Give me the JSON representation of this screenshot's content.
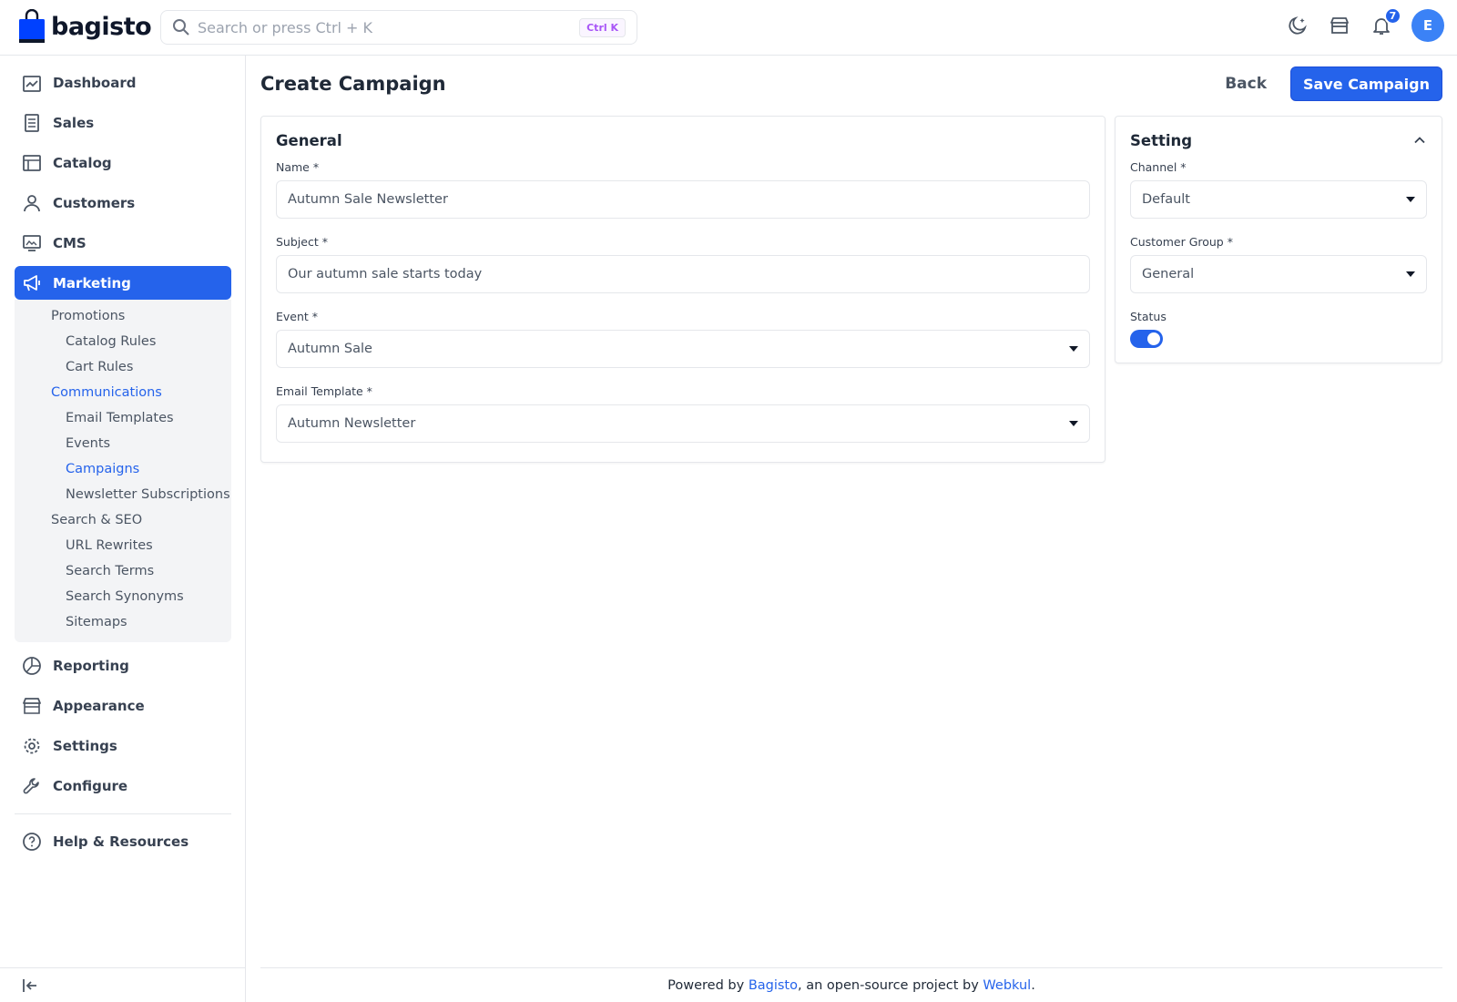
{
  "brand": {
    "name": "bagisto",
    "color": "#0041ff"
  },
  "search": {
    "placeholder": "Search or press Ctrl + K",
    "shortcut": "Ctrl K"
  },
  "header": {
    "notification_count": "7",
    "avatar_initial": "E"
  },
  "sidebar": {
    "items": [
      {
        "label": "Dashboard",
        "icon": "dashboard-icon"
      },
      {
        "label": "Sales",
        "icon": "receipt-icon"
      },
      {
        "label": "Catalog",
        "icon": "catalog-icon"
      },
      {
        "label": "Customers",
        "icon": "user-icon"
      },
      {
        "label": "CMS",
        "icon": "monitor-icon"
      },
      {
        "label": "Marketing",
        "icon": "megaphone-icon",
        "active": true
      },
      {
        "label": "Reporting",
        "icon": "pie-chart-icon"
      },
      {
        "label": "Appearance",
        "icon": "store-icon"
      },
      {
        "label": "Settings",
        "icon": "gear-icon"
      },
      {
        "label": "Configure",
        "icon": "wrench-icon"
      }
    ],
    "marketing_sub": {
      "promotions": "Promotions",
      "catalog_rules": "Catalog Rules",
      "cart_rules": "Cart Rules",
      "communications": "Communications",
      "email_templates": "Email Templates",
      "events": "Events",
      "campaigns": "Campaigns",
      "newsletter": "Newsletter Subscriptions",
      "search_seo": "Search & SEO",
      "url_rewrites": "URL Rewrites",
      "search_terms": "Search Terms",
      "search_synonyms": "Search Synonyms",
      "sitemaps": "Sitemaps"
    },
    "help": "Help & Resources"
  },
  "page": {
    "title": "Create Campaign",
    "back_label": "Back",
    "save_label": "Save Campaign"
  },
  "general": {
    "title": "General",
    "name_label": "Name *",
    "name_value": "Autumn Sale Newsletter",
    "subject_label": "Subject *",
    "subject_value": "Our autumn sale starts today",
    "event_label": "Event *",
    "event_value": "Autumn Sale",
    "template_label": "Email Template *",
    "template_value": "Autumn Newsletter"
  },
  "setting": {
    "title": "Setting",
    "channel_label": "Channel *",
    "channel_value": "Default",
    "group_label": "Customer Group *",
    "group_value": "General",
    "status_label": "Status",
    "status_on": true
  },
  "footer": {
    "prefix": "Powered by ",
    "link1": "Bagisto",
    "middle": ", an open-source project by ",
    "link2": "Webkul",
    "suffix": "."
  },
  "colors": {
    "accent": "#2563eb",
    "border": "#e5e7eb"
  }
}
